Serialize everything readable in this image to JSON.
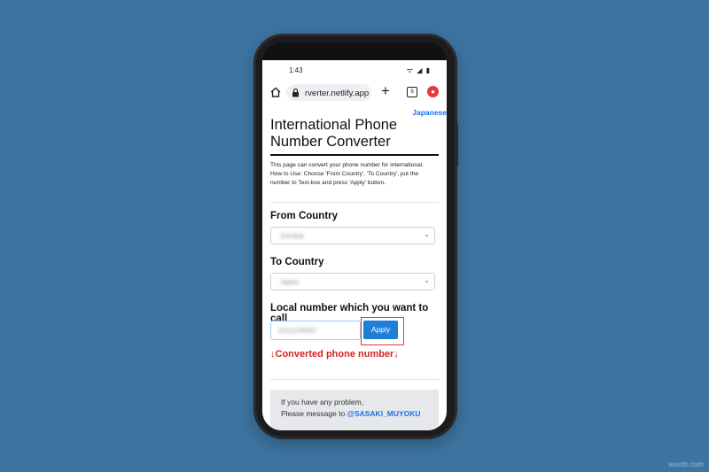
{
  "status_bar": {
    "time": "1:43",
    "icons": "ᯤ ◢ ▮"
  },
  "browser": {
    "url": "rverter.netlify.app",
    "tab_count": "9",
    "plus": "+",
    "menu": "●"
  },
  "page": {
    "language_link": "Japanese",
    "title": "International Phone Number Converter",
    "description": "This page can convert your phone number for international.\nHow to Use: Choose 'From Country', 'To Country', put the number to Text-box and press 'Apply' button.",
    "from_country": {
      "label": "From Country",
      "value": "Zambia"
    },
    "to_country": {
      "label": "To Country",
      "value": "Japan"
    },
    "local_number": {
      "label": "Local number which you want to call",
      "value": "0211234567"
    },
    "apply_label": "Apply",
    "converted_label": "↓Converted phone number↓",
    "footer": {
      "line1": "If you have any problem,",
      "line2_prefix": "Please message to ",
      "line2_link": "@SASAKI_MUYOKU"
    }
  },
  "watermark": "wsxdn.com",
  "colors": {
    "background": "#3d74a0",
    "accent": "#1e7ed8",
    "alert": "#d32222",
    "highlight": "#e03a3a"
  }
}
